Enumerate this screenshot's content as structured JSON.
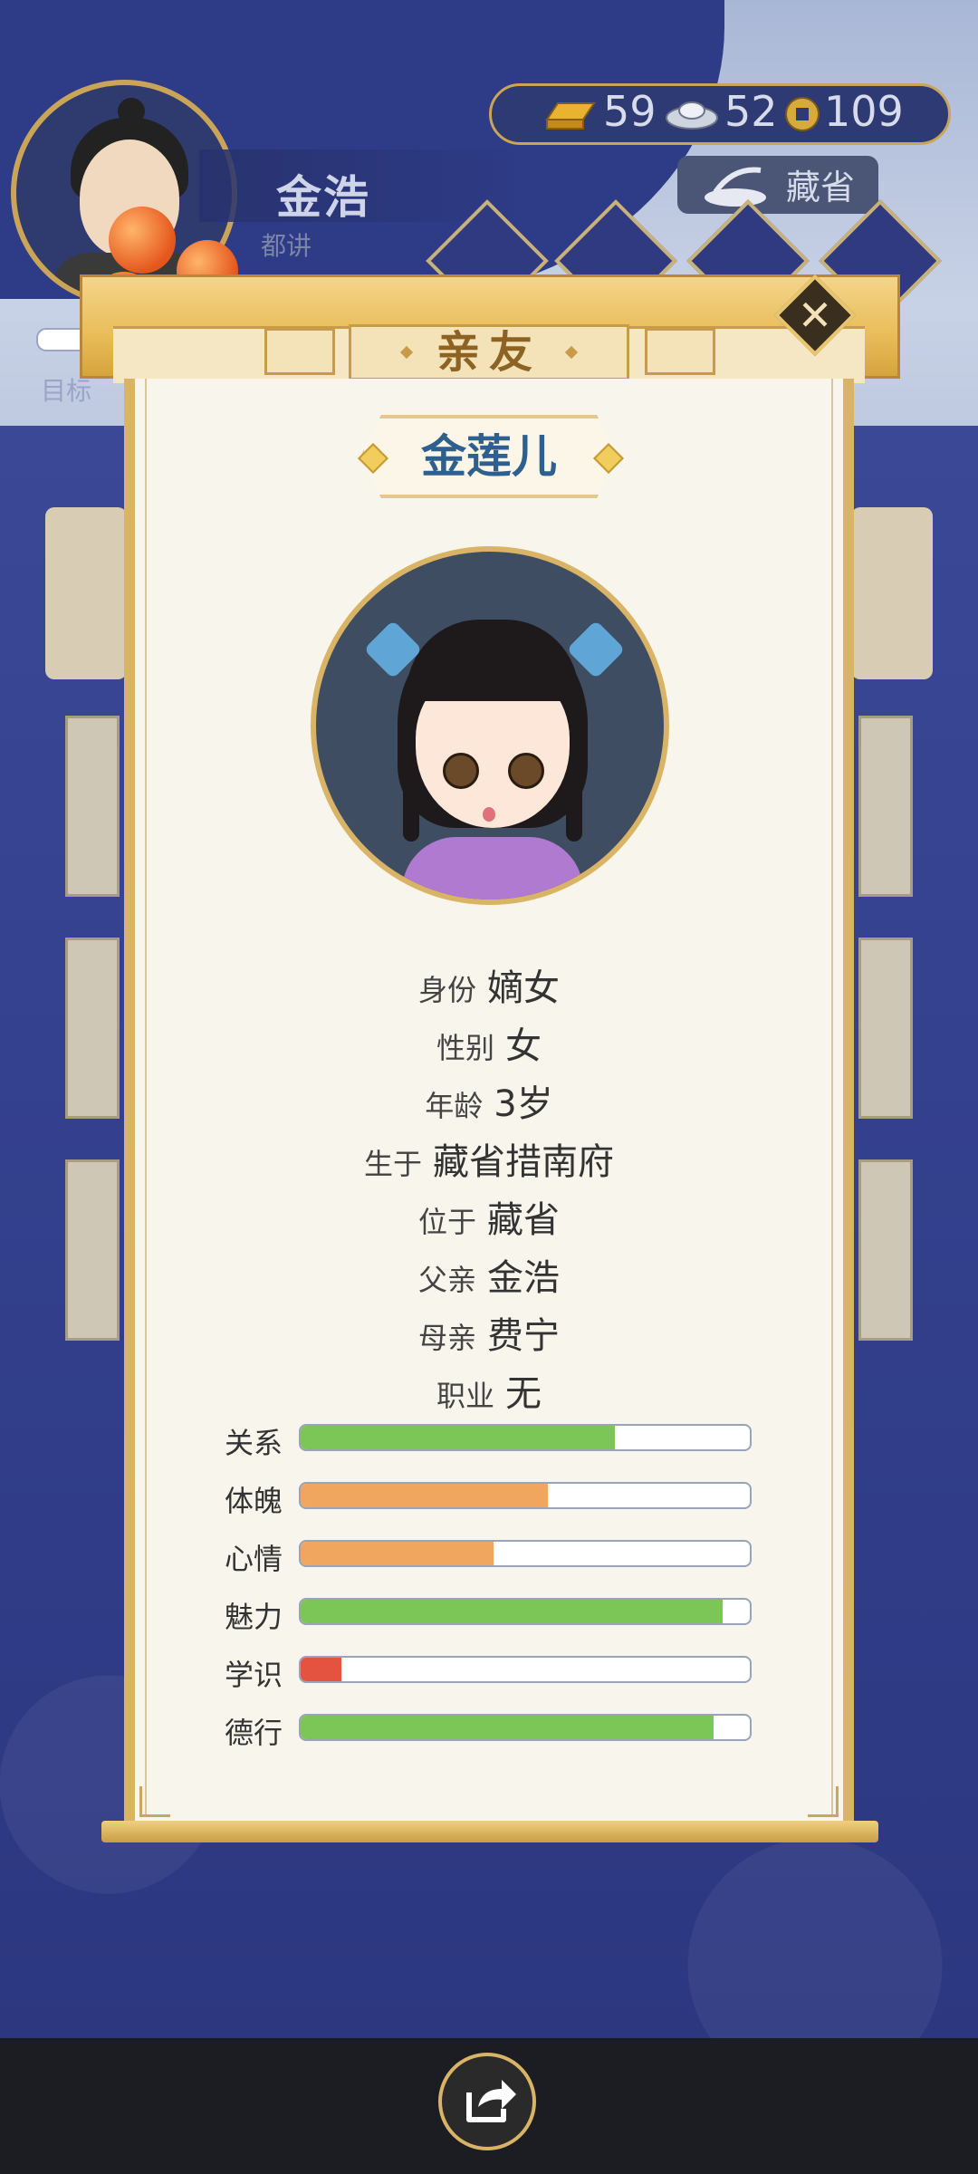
{
  "header": {
    "player_name": "金浩",
    "player_rank": "都讲",
    "target_label": "目标",
    "location": "藏省",
    "resources": [
      {
        "icon": "gold-ingot-icon",
        "value": "59"
      },
      {
        "icon": "silver-ingot-icon",
        "value": "52"
      },
      {
        "icon": "coin-icon",
        "value": "109"
      }
    ]
  },
  "modal": {
    "title": "亲友",
    "name": "金莲儿",
    "info": [
      {
        "label": "身份",
        "value": "嫡女"
      },
      {
        "label": "性别",
        "value": "女"
      },
      {
        "label": "年龄",
        "value": "3岁"
      },
      {
        "label": "生于",
        "value": "藏省措南府"
      },
      {
        "label": "位于",
        "value": "藏省"
      },
      {
        "label": "父亲",
        "value": "金浩"
      },
      {
        "label": "母亲",
        "value": "费宁"
      },
      {
        "label": "职业",
        "value": "无"
      }
    ],
    "stats": [
      {
        "label": "关系",
        "level": 0.7,
        "color": "#7cc657"
      },
      {
        "label": "体魄",
        "level": 0.55,
        "color": "#f1a660"
      },
      {
        "label": "心情",
        "level": 0.43,
        "color": "#f1a660"
      },
      {
        "label": "魅力",
        "level": 0.94,
        "color": "#7cc657"
      },
      {
        "label": "学识",
        "level": 0.09,
        "color": "#e3533f"
      },
      {
        "label": "德行",
        "level": 0.92,
        "color": "#7cc657"
      }
    ]
  },
  "colors": {
    "accent_gold": "#d9b466",
    "panel_bg": "#f8f5ec",
    "name_blue": "#2f5f8e"
  }
}
